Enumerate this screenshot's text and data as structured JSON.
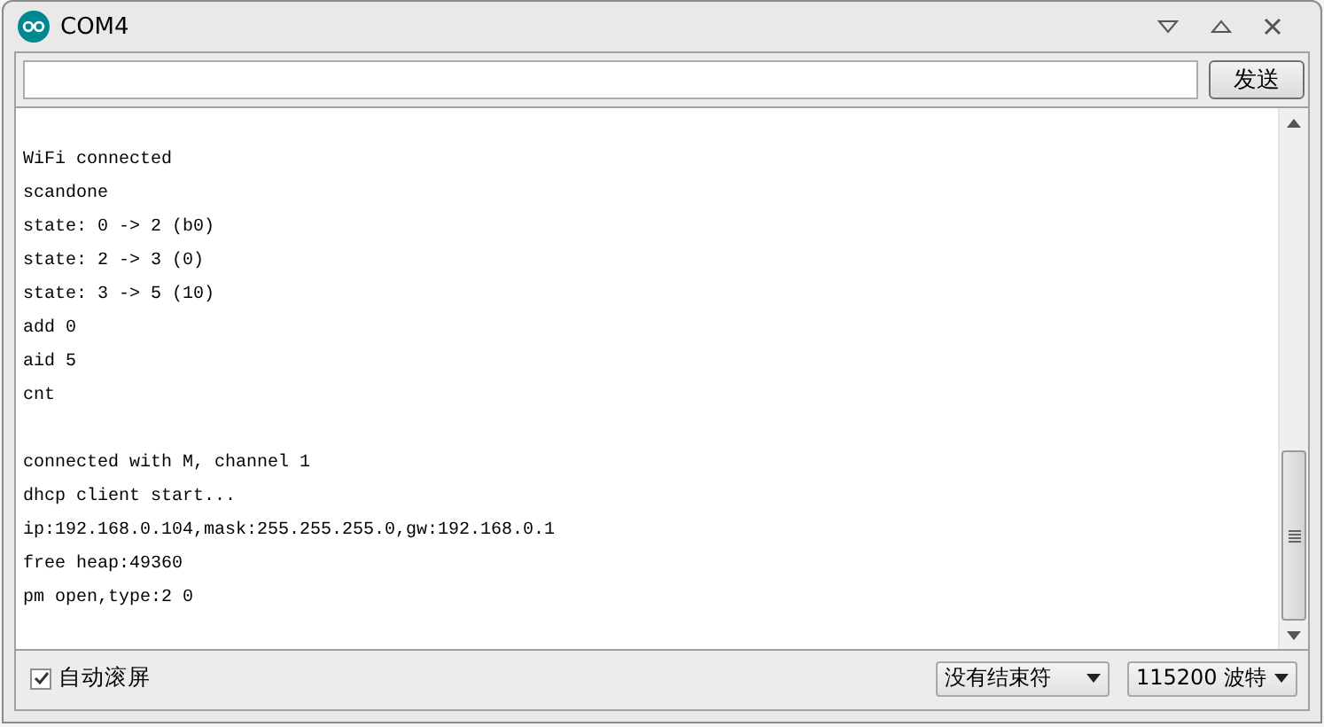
{
  "window": {
    "title": "COM4"
  },
  "send": {
    "button": "发送"
  },
  "output": {
    "blocks": [
      [
        "WiFi connected",
        "scandone",
        "state: 0 -> 2 (b0)",
        "state: 2 -> 3 (0)",
        "state: 3 -> 5 (10)",
        "add 0",
        "aid 5",
        "cnt"
      ],
      [
        "connected with M, channel 1",
        "dhcp client start...",
        "ip:192.168.0.104,mask:255.255.255.0,gw:192.168.0.1",
        "free heap:49360",
        "pm open,type:2 0"
      ]
    ]
  },
  "autoscroll": {
    "label": "自动滚屏",
    "checked": true
  },
  "line_ending": {
    "value": "没有结束符"
  },
  "baud": {
    "value": "115200 波特"
  }
}
